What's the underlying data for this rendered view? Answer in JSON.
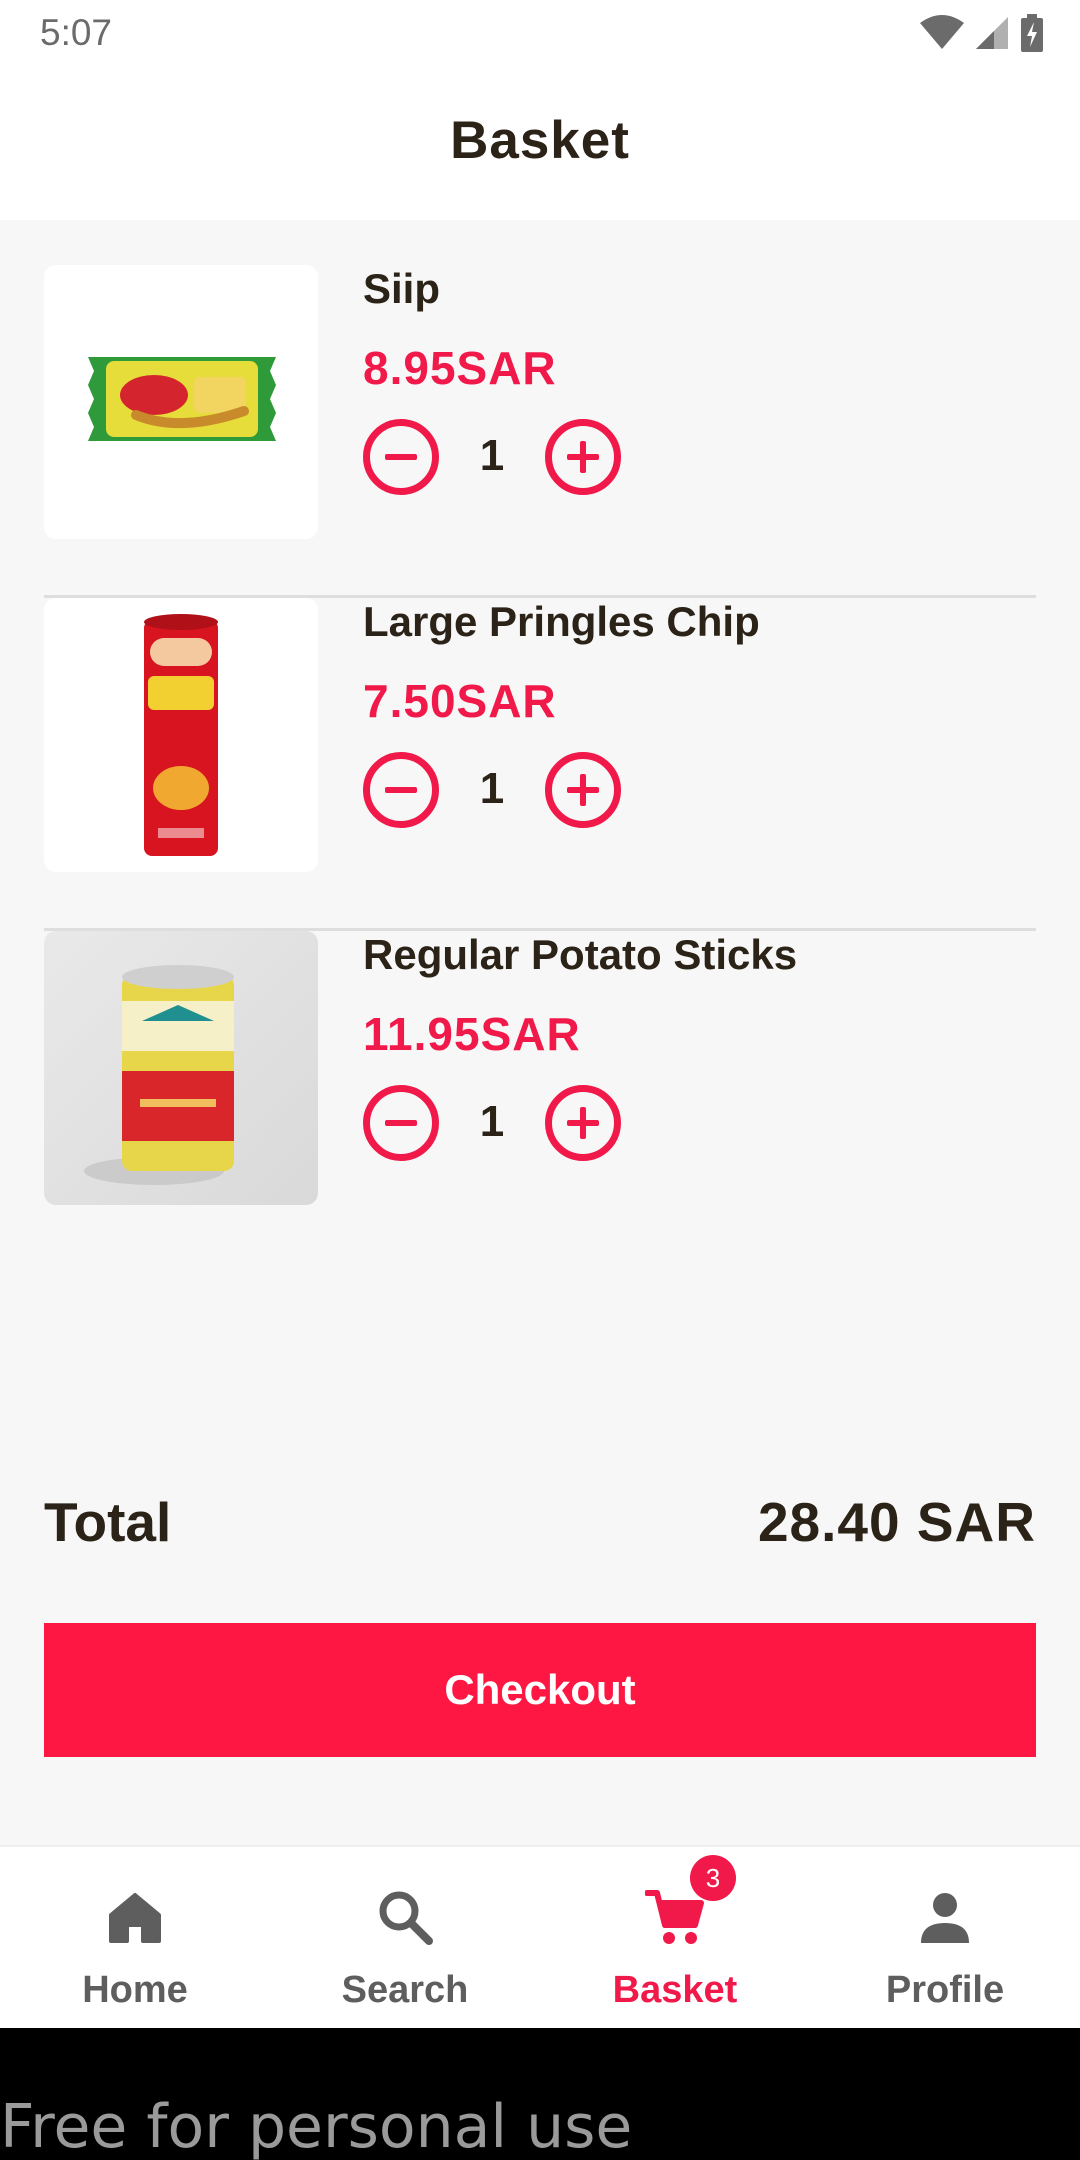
{
  "status_bar": {
    "time": "5:07",
    "icons": [
      "wifi-icon",
      "cellular-signal-icon",
      "battery-charging-icon"
    ]
  },
  "header": {
    "title": "Basket"
  },
  "cart": {
    "items": [
      {
        "name": "Siip",
        "price": "8.95SAR",
        "quantity": "1",
        "image": "siip-snack-product-image"
      },
      {
        "name": "Large Pringles Chip",
        "price": "7.50SAR",
        "quantity": "1",
        "image": "pringles-can-product-image"
      },
      {
        "name": "Regular Potato Sticks",
        "price": "11.95SAR",
        "quantity": "1",
        "image": "potato-sticks-can-product-image"
      }
    ]
  },
  "summary": {
    "total_label": "Total",
    "total_value": "28.40 SAR"
  },
  "checkout": {
    "label": "Checkout"
  },
  "bottom_nav": {
    "items": [
      {
        "label": "Home",
        "icon": "home-icon",
        "active": false
      },
      {
        "label": "Search",
        "icon": "search-icon",
        "active": false
      },
      {
        "label": "Basket",
        "icon": "cart-icon",
        "active": true,
        "badge": "3"
      },
      {
        "label": "Profile",
        "icon": "person-icon",
        "active": false
      }
    ]
  },
  "watermark": {
    "text": "Free for personal use"
  },
  "colors": {
    "accent": "#f0194a",
    "checkout_bg": "#ff1744",
    "text_dark": "#2b2218",
    "nav_inactive": "#5e5e5e",
    "background": "#f7f7f7"
  }
}
